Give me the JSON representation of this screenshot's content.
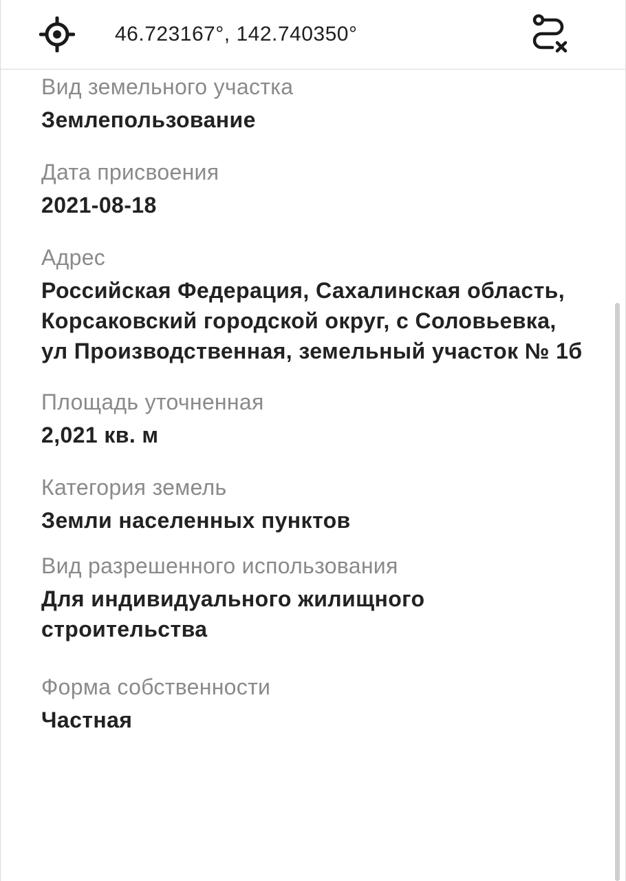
{
  "header": {
    "coordinates": "46.723167°, 142.740350°",
    "locate_icon": "crosshair-icon",
    "route_icon": "route-clear-icon"
  },
  "fields": [
    {
      "label": "Вид земельного участка",
      "value": "Землепользование"
    },
    {
      "label": "Дата присвоения",
      "value": "2021-08-18"
    },
    {
      "label": "Адрес",
      "value": "Российская Федерация, Сахалинская область, Корсаковский городской округ, с Соловьевка, ул Производственная, земельный участок № 1б"
    },
    {
      "label": "Площадь уточненная",
      "value": "2,021 кв. м"
    },
    {
      "label": "Категория земель",
      "value": "Земли населенных пунктов"
    },
    {
      "label": "Вид разрешенного использования",
      "value": "Для индивидуального жилищного строительства"
    },
    {
      "label": "Форма собственности",
      "value": "Частная"
    }
  ],
  "colors": {
    "label": "#8a8a8a",
    "value": "#222222",
    "divider": "#d6d6d6"
  }
}
